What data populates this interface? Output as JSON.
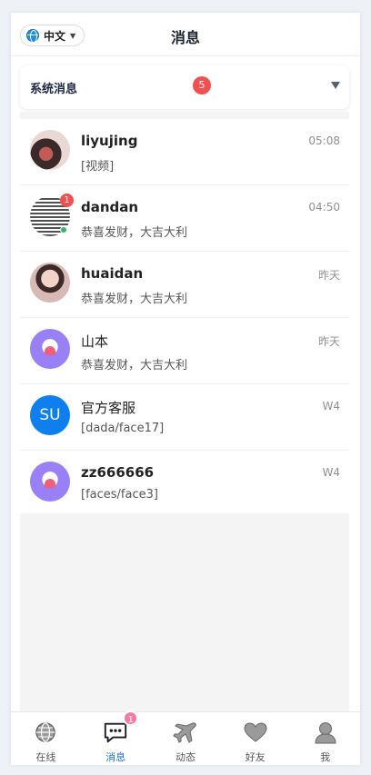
{
  "header": {
    "language": "中文",
    "title": "消息"
  },
  "system_messages": {
    "label": "系统消息",
    "count": "5"
  },
  "conversations": [
    {
      "name": "liyujing",
      "time": "05:08",
      "message": "[视频]",
      "unread": "",
      "avatar": "photo"
    },
    {
      "name": "dandan",
      "time": "04:50",
      "message": "恭喜发财，大吉大利",
      "unread": "1",
      "avatar": "qr-code"
    },
    {
      "name": "huaidan",
      "time": "昨天",
      "message": "恭喜发财，大吉大利",
      "unread": "",
      "avatar": "photo"
    },
    {
      "name": "山本",
      "time": "昨天",
      "message": "恭喜发财，大吉大利",
      "unread": "",
      "avatar": "ghost-heart"
    },
    {
      "name": "官方客服",
      "time": "W4",
      "message": "[dada/face17]",
      "unread": "",
      "avatar": "initials",
      "initials": "SU"
    },
    {
      "name": "zz666666",
      "time": "W4",
      "message": "[faces/face3]",
      "unread": "",
      "avatar": "ghost-heart"
    }
  ],
  "tabbar": {
    "items": [
      {
        "label": "在线",
        "icon": "globe-icon"
      },
      {
        "label": "消息",
        "icon": "chat-bubble-icon",
        "badge": "1",
        "active": true
      },
      {
        "label": "动态",
        "icon": "airplane-icon"
      },
      {
        "label": "好友",
        "icon": "heart-icon"
      },
      {
        "label": "我",
        "icon": "user-icon"
      }
    ]
  },
  "colors": {
    "accent": "#1a6fd0",
    "badge_red": "#f0504f",
    "tab_badge_pink": "#f37aa0"
  }
}
